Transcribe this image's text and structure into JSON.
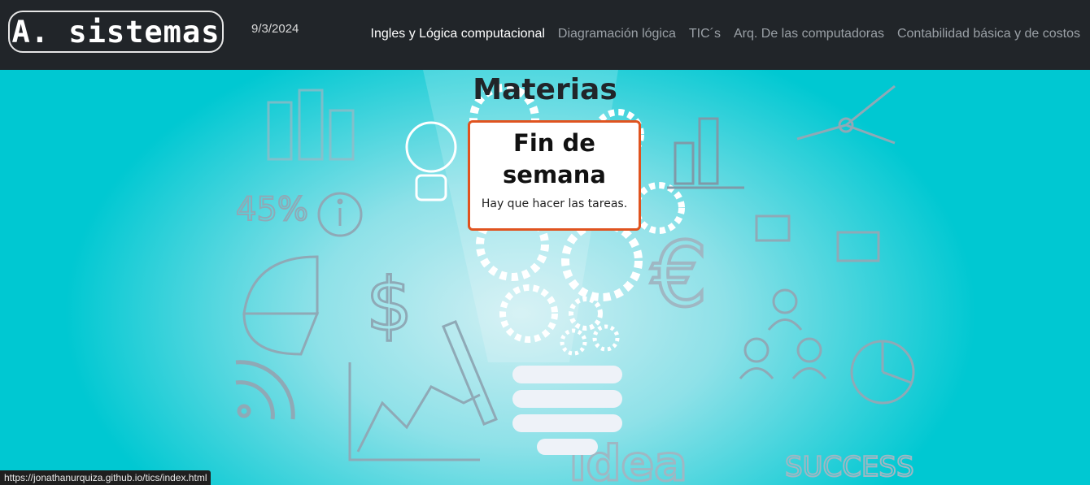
{
  "navbar": {
    "brand": "A. sistemas",
    "date": "9/3/2024",
    "links": [
      {
        "label": "Ingles y Lógica computacional",
        "active": true
      },
      {
        "label": "Diagramación lógica",
        "active": false
      },
      {
        "label": "TIC´s",
        "active": false
      },
      {
        "label": "Arq. De las computadoras",
        "active": false
      },
      {
        "label": "Contabilidad básica y de costos",
        "active": false
      }
    ]
  },
  "main": {
    "title": "Materias",
    "card": {
      "heading": "Fin de semana",
      "body": "Hay que hacer las tareas."
    },
    "background_art": {
      "doodle_percent": "45%",
      "doodle_word": "idea",
      "doodle_success": "SUCCESS"
    }
  },
  "status_bar": {
    "url": "https://jonathanurquiza.github.io/tics/index.html"
  },
  "colors": {
    "navbar_bg": "#212529",
    "hero_bg": "#00c8d2",
    "card_border": "#e0531f",
    "active_link": "#ffffff",
    "inactive_link": "#9aa0a6"
  }
}
